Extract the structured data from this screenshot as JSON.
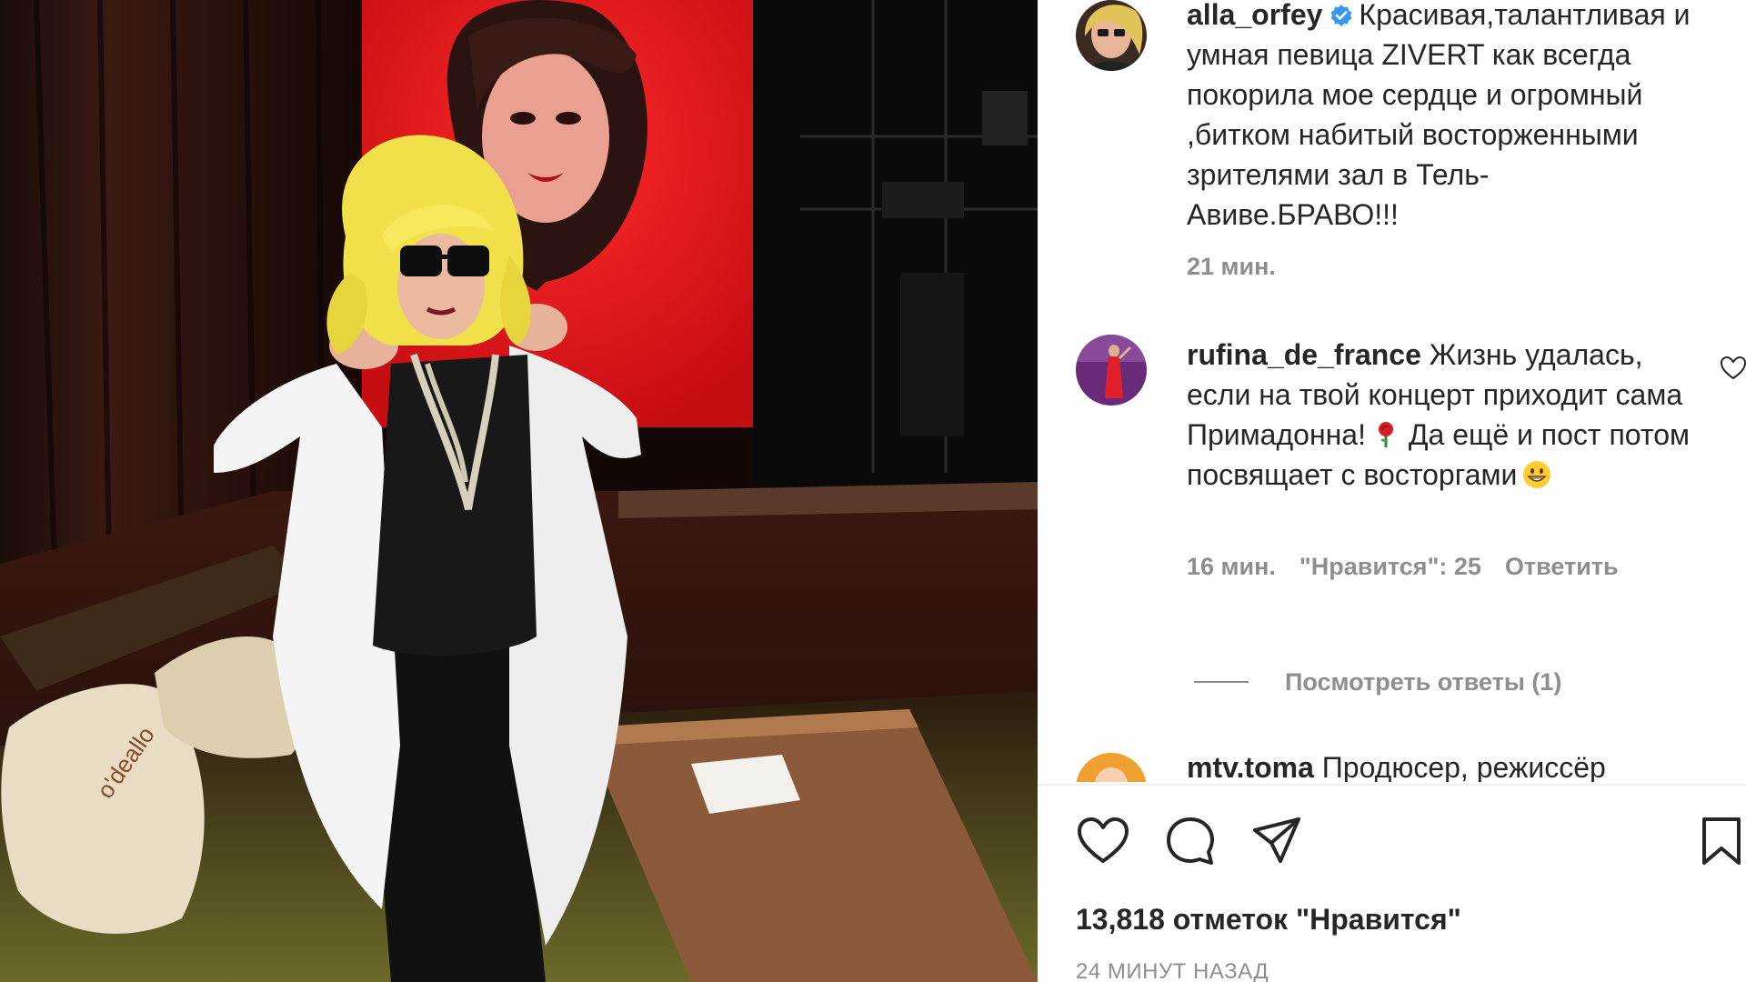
{
  "post": {
    "author": "alla_orfey",
    "caption": "Красивая,талантливая и умная певица ZIVERT как всегда покорила мое сердце и огромный ,битком набитый восторженными зрителями зал в Тель-Авиве.БРАВО!!!",
    "caption_time": "21 мин.",
    "likes_text": "13,818 отметок \"Нравится\"",
    "posted_ago": "24 МИНУТ НАЗАД"
  },
  "comments": [
    {
      "username": "rufina_de_france",
      "text": "Жизнь удалась, если на твой концерт приходит сама Примадонна!",
      "text_after_emoji": "Да ещё и пост потом посвящает с восторгами",
      "emoji1": "rose",
      "emoji2": "grinning-face",
      "time": "16 мин.",
      "likes": "\"Нравится\": 25",
      "reply_label": "Ответить"
    },
    {
      "username": "mtv.toma",
      "text": "Продюсер, режиссёр"
    }
  ],
  "view_replies": "Посмотреть ответы (1)",
  "icons": [
    "heart-icon",
    "comment-icon",
    "share-icon",
    "bookmark-icon",
    "verified-badge-icon"
  ],
  "colors": {
    "accent_blue": "#3897f0",
    "text": "#262626",
    "muted": "#8e8e8e"
  }
}
